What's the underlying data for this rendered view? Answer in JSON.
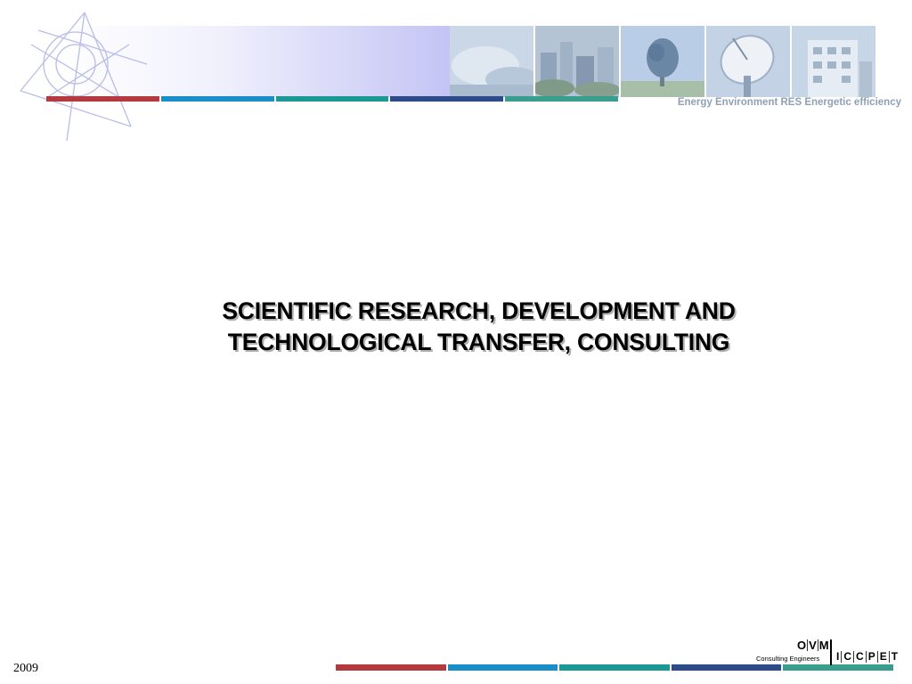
{
  "header": {
    "tagline": "Energy Environment  RES Energetic efficiency",
    "photos": [
      {
        "icon": "fog-landscape-photo"
      },
      {
        "icon": "city-buildings-photo"
      },
      {
        "icon": "tree-photo"
      },
      {
        "icon": "satellite-dish-photo"
      },
      {
        "icon": "building-photo"
      }
    ]
  },
  "slide": {
    "title_line1": "SCIENTIFIC RESEARCH, DEVELOPMENT AND",
    "title_line2": "TECHNOLOGICAL TRANSFER, CONSULTING"
  },
  "footer": {
    "year": "2009",
    "logo": {
      "top_letters": [
        "O",
        "V",
        "M"
      ],
      "subtitle": "Consulting Engineers",
      "right_letters": [
        "I",
        "C",
        "C",
        "P",
        "E",
        "T"
      ]
    }
  },
  "colors": {
    "bar_segments": [
      "#b53a3f",
      "#1a8fc7",
      "#1b9a95",
      "#2d4a8a",
      "#3a9e8e"
    ],
    "tagline": "#8fa0b6",
    "geo_lines": "#b8bde8"
  }
}
